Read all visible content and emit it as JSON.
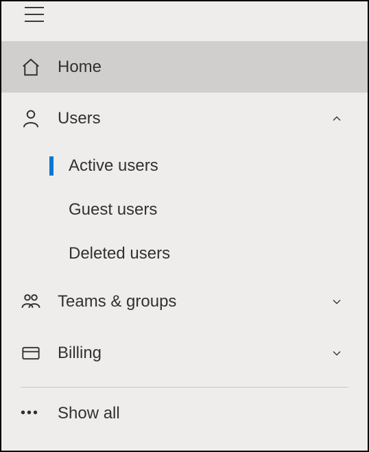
{
  "nav": {
    "home": "Home",
    "users": {
      "label": "Users",
      "expanded": true,
      "items": [
        "Active users",
        "Guest users",
        "Deleted users"
      ],
      "active_index": 0
    },
    "teams": {
      "label": "Teams & groups",
      "expanded": false
    },
    "billing": {
      "label": "Billing",
      "expanded": false
    },
    "show_all": "Show all"
  }
}
